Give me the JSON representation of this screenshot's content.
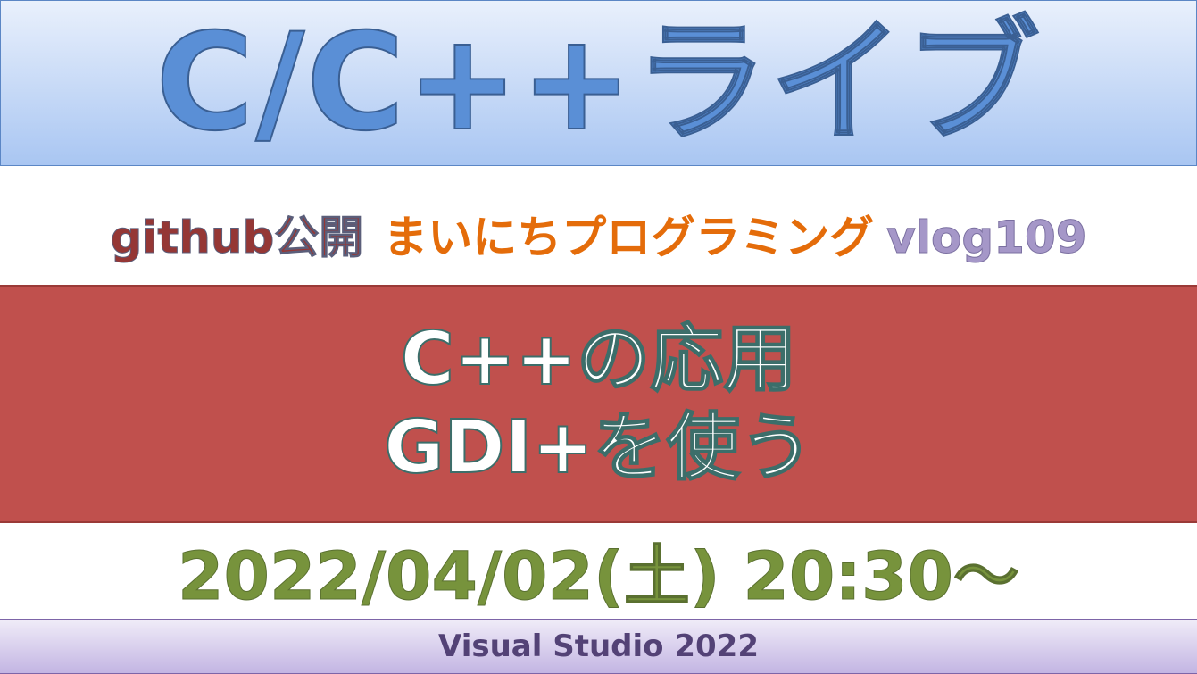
{
  "header": {
    "title": "C/C++ライブ"
  },
  "subtitle": {
    "github": "github公開",
    "series": "まいにちプログラミング",
    "episode": "vlog109"
  },
  "topic": {
    "line1": "C++の応用",
    "line2": "GDI+を使う"
  },
  "schedule": {
    "datetime": "2022/04/02(土) 20:30～"
  },
  "footer": {
    "tool": "Visual Studio 2022"
  },
  "colors": {
    "title": "#5a8fd6",
    "github": "#953735",
    "series": "#e46c0a",
    "episode": "#a597c8",
    "topic_bg": "#c0504d",
    "date": "#77933c",
    "footer_text": "#534276"
  }
}
